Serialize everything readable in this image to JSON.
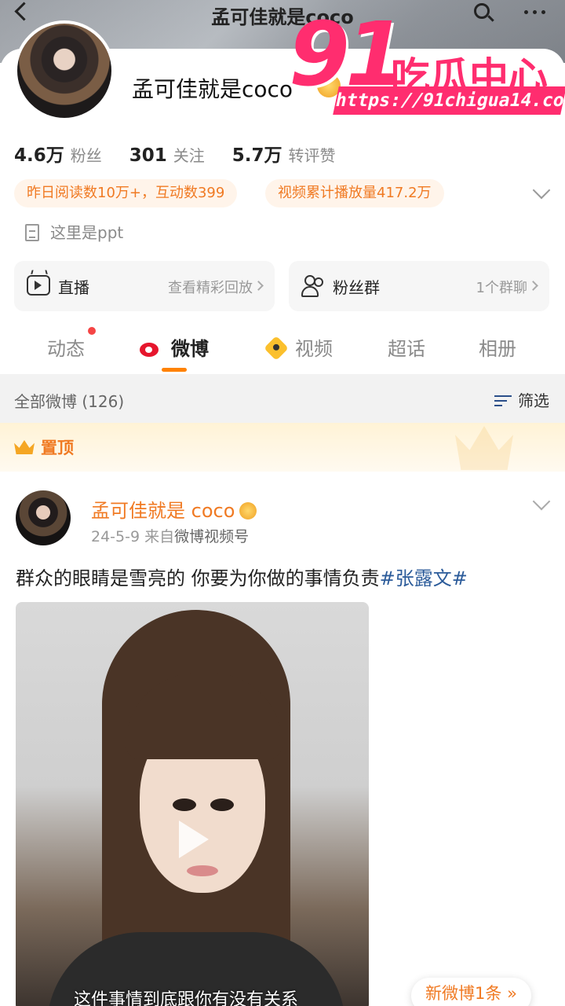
{
  "header": {
    "title": "孟可佳就是coco",
    "back_icon": "back-arrow-icon",
    "search_icon": "search-icon",
    "more_icon": "more-dots-icon"
  },
  "watermark": {
    "number": "91",
    "name": "吃瓜中心",
    "url": "https://91chigua14.com",
    "color": "#ff2d6f"
  },
  "profile": {
    "name": "孟可佳就是coco",
    "stats": [
      {
        "value": "4.6万",
        "label": "粉丝"
      },
      {
        "value": "301",
        "label": "关注"
      },
      {
        "value": "5.7万",
        "label": "转评赞"
      }
    ],
    "pills": [
      "昨日阅读数10万+，互动数399",
      "视频累计播放量417.2万"
    ],
    "bio": "这里是ppt",
    "entries": [
      {
        "title": "直播",
        "sub": "查看精彩回放",
        "icon": "tv-icon"
      },
      {
        "title": "粉丝群",
        "sub": "1个群聊",
        "icon": "group-icon"
      }
    ]
  },
  "tabs": [
    {
      "label": "动态",
      "active": false,
      "dot": true
    },
    {
      "label": "微博",
      "active": true
    },
    {
      "label": "视频",
      "active": false
    },
    {
      "label": "超话",
      "active": false
    },
    {
      "label": "相册",
      "active": false
    }
  ],
  "filter": {
    "label": "全部微博 (126)",
    "button": "筛选"
  },
  "pinned": {
    "label": "置顶"
  },
  "post": {
    "author": "孟可佳就是 coco",
    "date": "24-5-9",
    "source_prefix": "来自",
    "source": "微博视频号",
    "text": "群众的眼睛是雪亮的 你要为你做的事情负责",
    "tag": "#张露文#",
    "video_subtitle": "这件事情到底跟你有没有关系"
  },
  "toast": {
    "label": "新微博1条",
    "icon": "double-chevron-down-icon"
  },
  "colors": {
    "accent": "#ff8200",
    "orange_text": "#f07a23",
    "link": "#2b5b9a"
  }
}
